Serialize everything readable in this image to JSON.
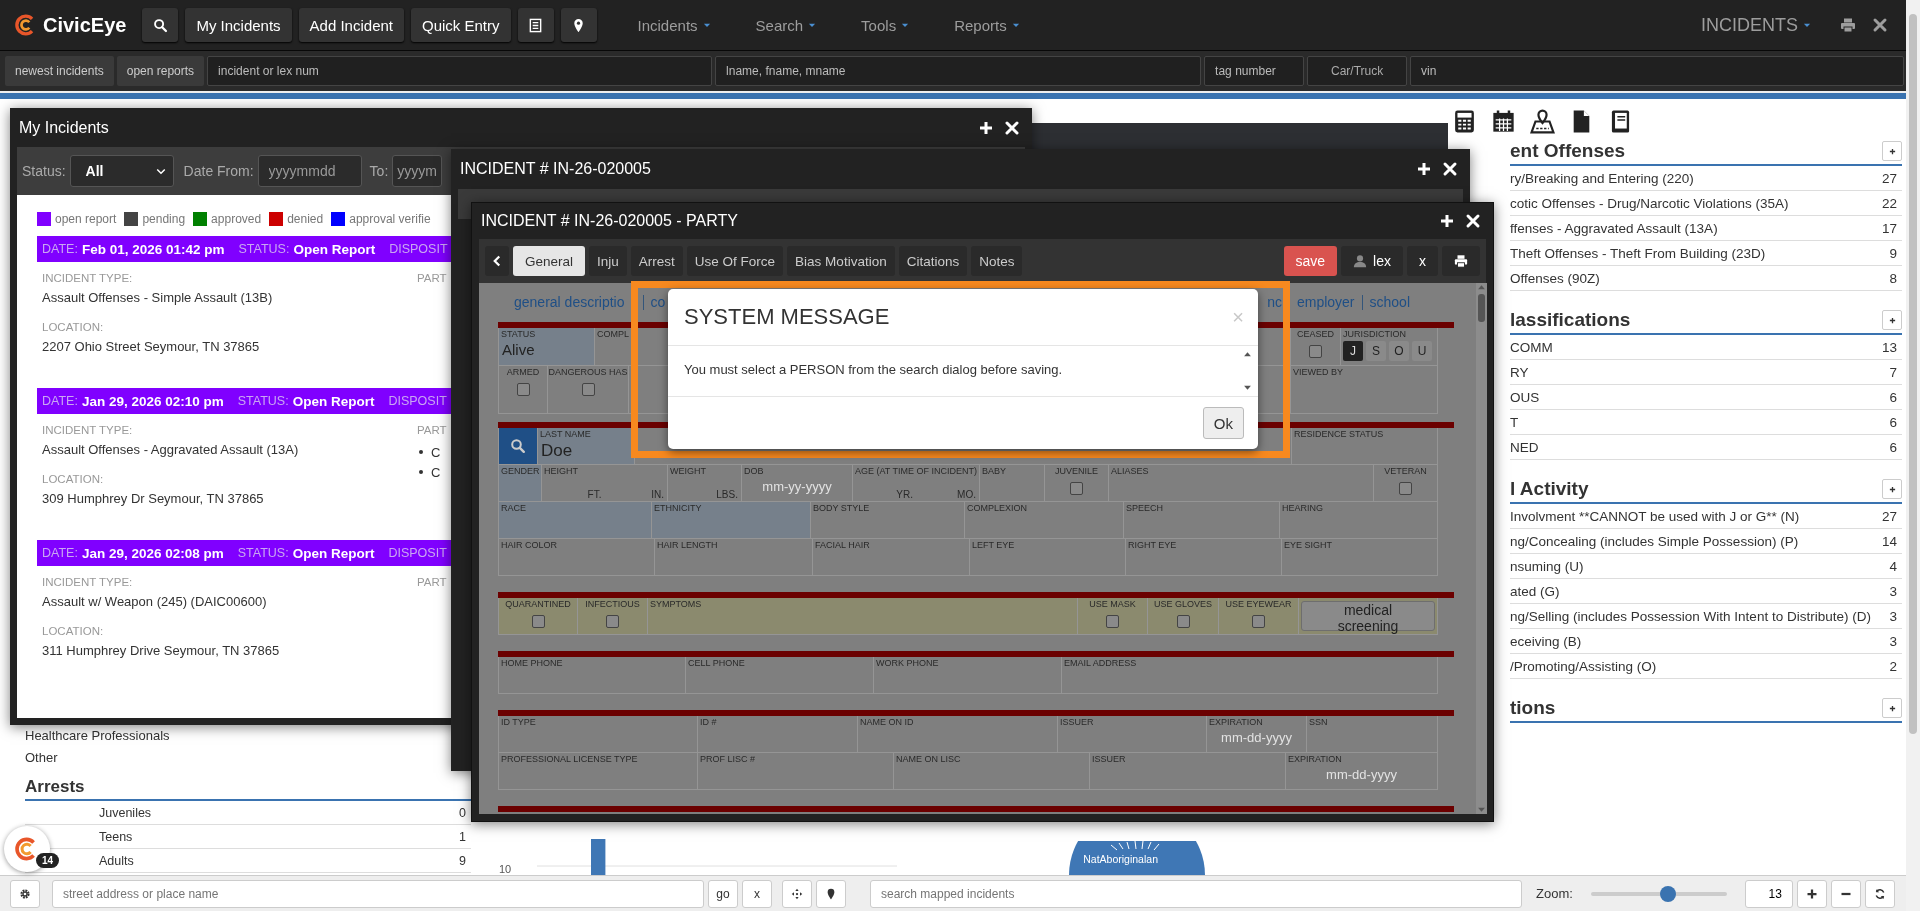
{
  "navbar": {
    "brand": "CivicEye",
    "buttons": [
      "My Incidents",
      "Add Incident",
      "Quick Entry"
    ],
    "menus": [
      "Incidents",
      "Search",
      "Tools",
      "Reports"
    ],
    "module": "INCIDENTS"
  },
  "quickbar": {
    "buttons": [
      "newest incidents",
      "open reports"
    ],
    "fields": [
      {
        "kind": "input",
        "placeholder": "incident or lex num"
      },
      {
        "kind": "input",
        "placeholder": "lname, fname, mname"
      },
      {
        "kind": "input",
        "placeholder": "tag number"
      },
      {
        "kind": "select",
        "value": "Car/Truck"
      },
      {
        "kind": "input",
        "placeholder": "vin"
      }
    ]
  },
  "dashboard": {
    "left_list": [
      "Healthcare Professionals",
      "Other"
    ],
    "arrests": {
      "title": "Arrests",
      "rows": [
        {
          "label": "Juveniles",
          "count": "0"
        },
        {
          "label": "Teens",
          "count": "1"
        },
        {
          "label": "Adults",
          "count": "9"
        }
      ]
    },
    "chart_tick": "10",
    "pie_label": "NatAboriginalan",
    "sections": [
      {
        "title": "ent Offenses",
        "rows": [
          {
            "label": "ry/Breaking and Entering (220)",
            "count": "27"
          },
          {
            "label": "cotic Offenses - Drug/Narcotic Violations (35A)",
            "count": "22"
          },
          {
            "label": "ffenses - Aggravated Assault (13A)",
            "count": "17"
          },
          {
            "label": "Theft Offenses - Theft From Building (23D)",
            "count": "9"
          },
          {
            "label": "Offenses (90Z)",
            "count": "8"
          }
        ]
      },
      {
        "title": "lassifications",
        "rows": [
          {
            "label": "COMM",
            "count": "13"
          },
          {
            "label": "RY",
            "count": "7"
          },
          {
            "label": "OUS",
            "count": "6"
          },
          {
            "label": "T",
            "count": "6"
          },
          {
            "label": "NED",
            "count": "6"
          }
        ]
      },
      {
        "title": "l Activity",
        "rows": [
          {
            "label": "Involvment **CANNOT be used with J or G** (N)",
            "count": "27"
          },
          {
            "label": "ng/Concealing (includes Simple Possession) (P)",
            "count": "14"
          },
          {
            "label": "nsuming (U)",
            "count": "4"
          },
          {
            "label": "ated (G)",
            "count": "3"
          },
          {
            "label": "ng/Selling (includes Possession With Intent to Distribute) (D)",
            "count": "3"
          },
          {
            "label": "eceiving (B)",
            "count": "3"
          },
          {
            "label": "/Promoting/Assisting (O)",
            "count": "2"
          }
        ]
      },
      {
        "title": "tions"
      }
    ],
    "badge": "14"
  },
  "my_incidents": {
    "title": "My Incidents",
    "status_label": "Status:",
    "status_value": "All",
    "date_from_label": "Date From:",
    "date_from_placeholder": "yyyymmdd",
    "to_label": "To:",
    "to_placeholder": "yyyym",
    "legend": [
      {
        "label": "open report",
        "color": "#8000ff"
      },
      {
        "label": "pending",
        "color": "#444444"
      },
      {
        "label": "approved",
        "color": "#008000"
      },
      {
        "label": "denied",
        "color": "#cc0000"
      },
      {
        "label": "approval verifie",
        "color": "#0000ff"
      }
    ],
    "incidents": [
      {
        "color": "#8000ff",
        "date_label": "DATE:",
        "date": "Feb 01, 2026 01:42 pm",
        "status_label": "STATUS:",
        "status": "Open Report",
        "disposition_label": "DISPOSIT",
        "type_label": "INCIDENT TYPE:",
        "type": "Assault Offenses - Simple Assault (13B)",
        "location_label": "LOCATION:",
        "location": "2207 Ohio Street Seymour, TN 37865",
        "party_label": "PART"
      },
      {
        "color": "#8000ff",
        "date_label": "DATE:",
        "date": "Jan 29, 2026 02:10 pm",
        "status_label": "STATUS:",
        "status": "Open Report",
        "disposition_label": "DISPOSIT",
        "type_label": "INCIDENT TYPE:",
        "type": "Assault Offenses - Aggravated Assault (13A)",
        "location_label": "LOCATION:",
        "location": "309 Humphrey Dr Seymour, TN 37865",
        "party_label": "PART",
        "parties": [
          "C",
          "C"
        ]
      },
      {
        "color": "#8000ff",
        "date_label": "DATE:",
        "date": "Jan 29, 2026 02:08 pm",
        "status_label": "STATUS:",
        "status": "Open Report",
        "disposition_label": "DISPOSIT",
        "type_label": "INCIDENT TYPE:",
        "type": "Assault w/ Weapon (245) (DAIC00600)",
        "location_label": "LOCATION:",
        "location": "311 Humphrey Drive Seymour, TN 37865",
        "party_label": "PART"
      }
    ]
  },
  "incident_window": {
    "title": "INCIDENT # IN-26-020005"
  },
  "party_window": {
    "title": "INCIDENT # IN-26-020005 - PARTY",
    "tabs": [
      {
        "label": "General",
        "selected": true
      },
      {
        "label": "Inju",
        "selected": false
      },
      {
        "label": "Arrest",
        "selected": false
      },
      {
        "label": "Use Of Force",
        "selected": false
      },
      {
        "label": "Bias Motivation",
        "selected": false
      },
      {
        "label": "Citations",
        "selected": false
      },
      {
        "label": "Notes",
        "selected": false
      }
    ],
    "save": "save",
    "user": "lex",
    "close": "x",
    "subnav_left": [
      "general descriptio",
      "co"
    ],
    "subnav_right": [
      "nc",
      "employer",
      "school"
    ],
    "sections": [
      {
        "highlighted": false,
        "divider": true,
        "rows": [
          {
            "cells": [
              {
                "kind": "select",
                "label": "STATUS",
                "value": "Alive"
              },
              {
                "kind": "text",
                "label": "COMPL"
              },
              {
                "kind": "check",
                "label": "CEASED",
                "checked": false
              },
              {
                "kind": "juris",
                "label": "JURISDICTION",
                "options": [
                  {
                    "label": "J",
                    "selected": true
                  },
                  {
                    "label": "S",
                    "selected": false
                  },
                  {
                    "label": "O",
                    "selected": false
                  },
                  {
                    "label": "U",
                    "selected": false
                  }
                ]
              }
            ]
          },
          {
            "cells": [
              {
                "kind": "check",
                "label": "ARMED",
                "checked": false
              },
              {
                "kind": "check",
                "label": "DANGEROUS HAS",
                "checked": false
              },
              {
                "kind": "text",
                "label": "VIEWED BY"
              }
            ]
          }
        ]
      },
      {
        "highlighted": false,
        "divider": true,
        "rows": [
          {
            "cells": [
              {
                "kind": "search"
              },
              {
                "kind": "filled",
                "label": "LAST NAME",
                "value": "Doe"
              },
              {
                "kind": "text",
                "label": "RESIDENCE STATUS"
              }
            ]
          }
        ]
      },
      {
        "highlighted": false,
        "divider": false,
        "rows": [
          {
            "cells": [
              {
                "kind": "select",
                "label": "GENDER"
              },
              {
                "kind": "text",
                "label": "HEIGHT",
                "units": [
                  "FT.",
                  "IN."
                ]
              },
              {
                "kind": "text",
                "label": "WEIGHT",
                "units": [
                  "LBS."
                ]
              },
              {
                "kind": "text",
                "label": "DOB",
                "placeholder": "mm-yy-yyyy"
              },
              {
                "kind": "text",
                "label": "AGE (AT TIME OF INCIDENT)",
                "units": [
                  "YR.",
                  "MO."
                ]
              },
              {
                "kind": "text",
                "label": "BABY"
              },
              {
                "kind": "check",
                "label": "JUVENILE",
                "checked": false
              },
              {
                "kind": "text",
                "label": "ALIASES"
              },
              {
                "kind": "check",
                "label": "VETERAN",
                "checked": false
              }
            ]
          }
        ]
      },
      {
        "highlighted": false,
        "divider": false,
        "rows": [
          {
            "cells": [
              {
                "kind": "select",
                "label": "RACE"
              },
              {
                "kind": "select",
                "label": "ETHNICITY"
              },
              {
                "kind": "text",
                "label": "BODY STYLE"
              },
              {
                "kind": "text",
                "label": "COMPLEXION"
              },
              {
                "kind": "text",
                "label": "SPEECH"
              },
              {
                "kind": "text",
                "label": "HEARING"
              }
            ]
          },
          {
            "cells": [
              {
                "kind": "text",
                "label": "HAIR COLOR"
              },
              {
                "kind": "text",
                "label": "HAIR LENGTH"
              },
              {
                "kind": "text",
                "label": "FACIAL HAIR"
              },
              {
                "kind": "text",
                "label": "LEFT EYE"
              },
              {
                "kind": "text",
                "label": "RIGHT EYE"
              },
              {
                "kind": "text",
                "label": "EYE SIGHT"
              }
            ]
          }
        ]
      },
      {
        "highlighted": true,
        "divider": true,
        "rows": [
          {
            "cells": [
              {
                "kind": "check",
                "label": "QUARANTINED",
                "checked": false
              },
              {
                "kind": "check",
                "label": "INFECTIOUS",
                "checked": false
              },
              {
                "kind": "text",
                "label": "SYMPTOMS"
              },
              {
                "kind": "check",
                "label": "USE MASK",
                "checked": false
              },
              {
                "kind": "check",
                "label": "USE GLOVES",
                "checked": false
              },
              {
                "kind": "check",
                "label": "USE EYEWEAR",
                "checked": false
              },
              {
                "kind": "button",
                "label": "medical screening"
              }
            ]
          }
        ]
      },
      {
        "highlighted": false,
        "divider": true,
        "rows": [
          {
            "cells": [
              {
                "kind": "text",
                "label": "HOME PHONE"
              },
              {
                "kind": "text",
                "label": "CELL PHONE"
              },
              {
                "kind": "text",
                "label": "WORK PHONE"
              },
              {
                "kind": "text",
                "label": "EMAIL ADDRESS"
              }
            ]
          }
        ]
      },
      {
        "highlighted": false,
        "divider": true,
        "rows": [
          {
            "cells": [
              {
                "kind": "text",
                "label": "ID TYPE"
              },
              {
                "kind": "text",
                "label": "ID #"
              },
              {
                "kind": "text",
                "label": "NAME ON ID"
              },
              {
                "kind": "text",
                "label": "ISSUER"
              },
              {
                "kind": "text",
                "label": "EXPIRATION",
                "placeholder": "mm-dd-yyyy"
              },
              {
                "kind": "text",
                "label": "SSN"
              }
            ]
          }
        ]
      },
      {
        "highlighted": false,
        "divider": false,
        "rows": [
          {
            "cells": [
              {
                "kind": "text",
                "label": "PROFESSIONAL LICENSE TYPE"
              },
              {
                "kind": "text",
                "label": "PROF LISC #"
              },
              {
                "kind": "text",
                "label": "NAME ON LISC"
              },
              {
                "kind": "text",
                "label": "ISSUER"
              },
              {
                "kind": "text",
                "label": "EXPIRATION",
                "placeholder": "mm-dd-yyyy"
              }
            ]
          }
        ]
      }
    ]
  },
  "modal": {
    "title": "SYSTEM MESSAGE",
    "close": "×",
    "message": "You must select a PERSON from the search dialog before saving.",
    "button": "Ok"
  },
  "bottom_bar": {
    "address_placeholder": "street address or place name",
    "go": "go",
    "clear": "x",
    "search_placeholder": "search mapped incidents",
    "zoom_label": "Zoom:",
    "zoom": {
      "level": 0.56
    },
    "zoom_value": "13"
  }
}
